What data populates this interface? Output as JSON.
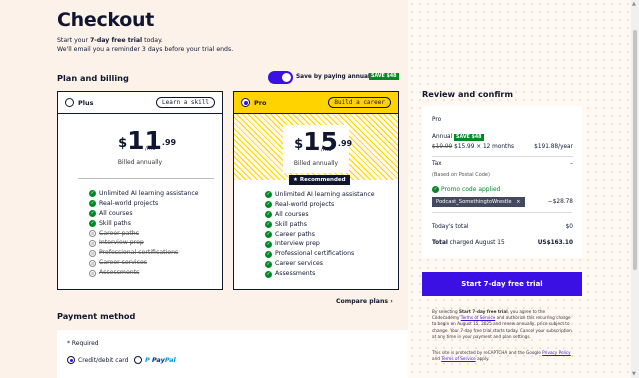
{
  "header": {
    "title": "Checkout",
    "sub1_prefix": "Start your ",
    "sub1_bold": "7-day free trial",
    "sub1_suffix": " today.",
    "sub2": "We'll email you a reminder 3 days before your trial ends."
  },
  "billing": {
    "title": "Plan and billing",
    "toggle_label": "Save by paying annually",
    "toggle_on": true,
    "save_badge": "SAVE $48"
  },
  "plans": [
    {
      "name": "Plus",
      "tag": "Learn a skill",
      "currency": "$",
      "price": "11",
      "cents": ".99",
      "per": "/mo",
      "billed": "Billed annually",
      "selected": false,
      "features": [
        {
          "text": "Unlimited AI learning assistance",
          "included": true
        },
        {
          "text": "Real-world projects",
          "included": true
        },
        {
          "text": "All courses",
          "included": true
        },
        {
          "text": "Skill paths",
          "included": true
        },
        {
          "text": "Career paths",
          "included": false
        },
        {
          "text": "Interview prep",
          "included": false
        },
        {
          "text": "Professional certifications",
          "included": false
        },
        {
          "text": "Career services",
          "included": false
        },
        {
          "text": "Assessments",
          "included": false
        }
      ]
    },
    {
      "name": "Pro",
      "tag": "Build a career",
      "currency": "$",
      "price": "15",
      "cents": ".99",
      "per": "/mo",
      "billed": "Billed annually",
      "recommended": "Recommended",
      "selected": true,
      "features": [
        {
          "text": "Unlimited AI learning assistance",
          "included": true
        },
        {
          "text": "Real-world projects",
          "included": true
        },
        {
          "text": "All courses",
          "included": true
        },
        {
          "text": "Skill paths",
          "included": true
        },
        {
          "text": "Career paths",
          "included": true
        },
        {
          "text": "Interview prep",
          "included": true
        },
        {
          "text": "Professional certifications",
          "included": true
        },
        {
          "text": "Career services",
          "included": true
        },
        {
          "text": "Assessments",
          "included": true
        }
      ]
    }
  ],
  "compare_label": "Compare plans",
  "payment": {
    "title": "Payment method",
    "required": "* Required",
    "card_label": "Credit/debit card",
    "paypal_a": "Pay",
    "paypal_b": "Pal",
    "card_selected": true
  },
  "review": {
    "title": "Review and confirm",
    "plan": "Pro",
    "annual_label": "Annual",
    "save_badge": "SAVE $48",
    "old_price": "$19.99",
    "new_price": "$15.99 × 12 months",
    "annual_total": "$191.88/year",
    "tax_label": "Tax",
    "tax_value": "–",
    "tax_note": "(Based on Postal Code)",
    "promo_applied": "Promo code applied",
    "promo_code": "Podcast_SomethingtoWrestle",
    "promo_remove": "×",
    "promo_discount": "−$28.78",
    "today_label": "Today's total",
    "today_value": "$0",
    "total_label_bold": "Total",
    "total_label_rest": " charged August 15",
    "total_value": "US$163.10"
  },
  "cta": "Start 7-day free trial",
  "fine": {
    "p1_a": "By selecting ",
    "p1_b": "Start 7-day free trial",
    "p1_c": ", you agree to the Codecademy ",
    "p1_link": "Terms of Service",
    "p1_d": " and authorize this recurring charge to begin on August 15, 2025 and renew annually, price subject to change. Your 7-day free trial starts today. Cancel your subscription at any time in your payment and plan settings.",
    "p2_a": "This site is protected by reCAPTCHA and the Google ",
    "p2_link1": "Privacy Policy",
    "p2_b": " and ",
    "p2_link2": "Terms of Service",
    "p2_c": " apply."
  },
  "colors": {
    "accent": "#3a10e5",
    "pro_yellow": "#ffd300",
    "success": "#008a27",
    "navy": "#10162f",
    "page_bg": "#fdf2ea"
  }
}
